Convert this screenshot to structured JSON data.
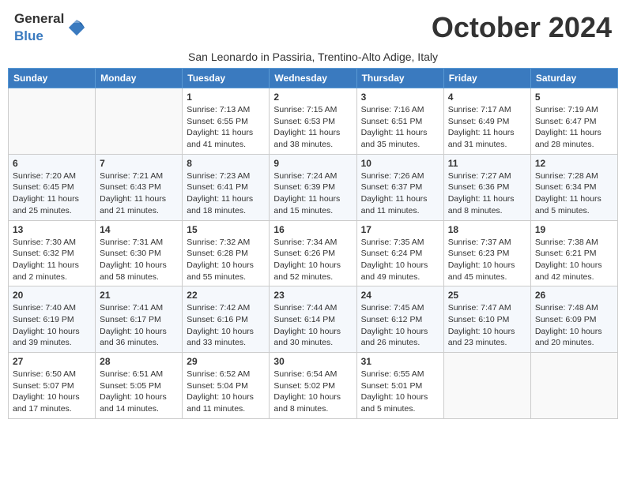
{
  "header": {
    "logo_general": "General",
    "logo_blue": "Blue",
    "month_title": "October 2024",
    "subtitle": "San Leonardo in Passiria, Trentino-Alto Adige, Italy"
  },
  "days_of_week": [
    "Sunday",
    "Monday",
    "Tuesday",
    "Wednesday",
    "Thursday",
    "Friday",
    "Saturday"
  ],
  "weeks": [
    [
      {
        "day": "",
        "info": ""
      },
      {
        "day": "",
        "info": ""
      },
      {
        "day": "1",
        "info": "Sunrise: 7:13 AM\nSunset: 6:55 PM\nDaylight: 11 hours and 41 minutes."
      },
      {
        "day": "2",
        "info": "Sunrise: 7:15 AM\nSunset: 6:53 PM\nDaylight: 11 hours and 38 minutes."
      },
      {
        "day": "3",
        "info": "Sunrise: 7:16 AM\nSunset: 6:51 PM\nDaylight: 11 hours and 35 minutes."
      },
      {
        "day": "4",
        "info": "Sunrise: 7:17 AM\nSunset: 6:49 PM\nDaylight: 11 hours and 31 minutes."
      },
      {
        "day": "5",
        "info": "Sunrise: 7:19 AM\nSunset: 6:47 PM\nDaylight: 11 hours and 28 minutes."
      }
    ],
    [
      {
        "day": "6",
        "info": "Sunrise: 7:20 AM\nSunset: 6:45 PM\nDaylight: 11 hours and 25 minutes."
      },
      {
        "day": "7",
        "info": "Sunrise: 7:21 AM\nSunset: 6:43 PM\nDaylight: 11 hours and 21 minutes."
      },
      {
        "day": "8",
        "info": "Sunrise: 7:23 AM\nSunset: 6:41 PM\nDaylight: 11 hours and 18 minutes."
      },
      {
        "day": "9",
        "info": "Sunrise: 7:24 AM\nSunset: 6:39 PM\nDaylight: 11 hours and 15 minutes."
      },
      {
        "day": "10",
        "info": "Sunrise: 7:26 AM\nSunset: 6:37 PM\nDaylight: 11 hours and 11 minutes."
      },
      {
        "day": "11",
        "info": "Sunrise: 7:27 AM\nSunset: 6:36 PM\nDaylight: 11 hours and 8 minutes."
      },
      {
        "day": "12",
        "info": "Sunrise: 7:28 AM\nSunset: 6:34 PM\nDaylight: 11 hours and 5 minutes."
      }
    ],
    [
      {
        "day": "13",
        "info": "Sunrise: 7:30 AM\nSunset: 6:32 PM\nDaylight: 11 hours and 2 minutes."
      },
      {
        "day": "14",
        "info": "Sunrise: 7:31 AM\nSunset: 6:30 PM\nDaylight: 10 hours and 58 minutes."
      },
      {
        "day": "15",
        "info": "Sunrise: 7:32 AM\nSunset: 6:28 PM\nDaylight: 10 hours and 55 minutes."
      },
      {
        "day": "16",
        "info": "Sunrise: 7:34 AM\nSunset: 6:26 PM\nDaylight: 10 hours and 52 minutes."
      },
      {
        "day": "17",
        "info": "Sunrise: 7:35 AM\nSunset: 6:24 PM\nDaylight: 10 hours and 49 minutes."
      },
      {
        "day": "18",
        "info": "Sunrise: 7:37 AM\nSunset: 6:23 PM\nDaylight: 10 hours and 45 minutes."
      },
      {
        "day": "19",
        "info": "Sunrise: 7:38 AM\nSunset: 6:21 PM\nDaylight: 10 hours and 42 minutes."
      }
    ],
    [
      {
        "day": "20",
        "info": "Sunrise: 7:40 AM\nSunset: 6:19 PM\nDaylight: 10 hours and 39 minutes."
      },
      {
        "day": "21",
        "info": "Sunrise: 7:41 AM\nSunset: 6:17 PM\nDaylight: 10 hours and 36 minutes."
      },
      {
        "day": "22",
        "info": "Sunrise: 7:42 AM\nSunset: 6:16 PM\nDaylight: 10 hours and 33 minutes."
      },
      {
        "day": "23",
        "info": "Sunrise: 7:44 AM\nSunset: 6:14 PM\nDaylight: 10 hours and 30 minutes."
      },
      {
        "day": "24",
        "info": "Sunrise: 7:45 AM\nSunset: 6:12 PM\nDaylight: 10 hours and 26 minutes."
      },
      {
        "day": "25",
        "info": "Sunrise: 7:47 AM\nSunset: 6:10 PM\nDaylight: 10 hours and 23 minutes."
      },
      {
        "day": "26",
        "info": "Sunrise: 7:48 AM\nSunset: 6:09 PM\nDaylight: 10 hours and 20 minutes."
      }
    ],
    [
      {
        "day": "27",
        "info": "Sunrise: 6:50 AM\nSunset: 5:07 PM\nDaylight: 10 hours and 17 minutes."
      },
      {
        "day": "28",
        "info": "Sunrise: 6:51 AM\nSunset: 5:05 PM\nDaylight: 10 hours and 14 minutes."
      },
      {
        "day": "29",
        "info": "Sunrise: 6:52 AM\nSunset: 5:04 PM\nDaylight: 10 hours and 11 minutes."
      },
      {
        "day": "30",
        "info": "Sunrise: 6:54 AM\nSunset: 5:02 PM\nDaylight: 10 hours and 8 minutes."
      },
      {
        "day": "31",
        "info": "Sunrise: 6:55 AM\nSunset: 5:01 PM\nDaylight: 10 hours and 5 minutes."
      },
      {
        "day": "",
        "info": ""
      },
      {
        "day": "",
        "info": ""
      }
    ]
  ]
}
